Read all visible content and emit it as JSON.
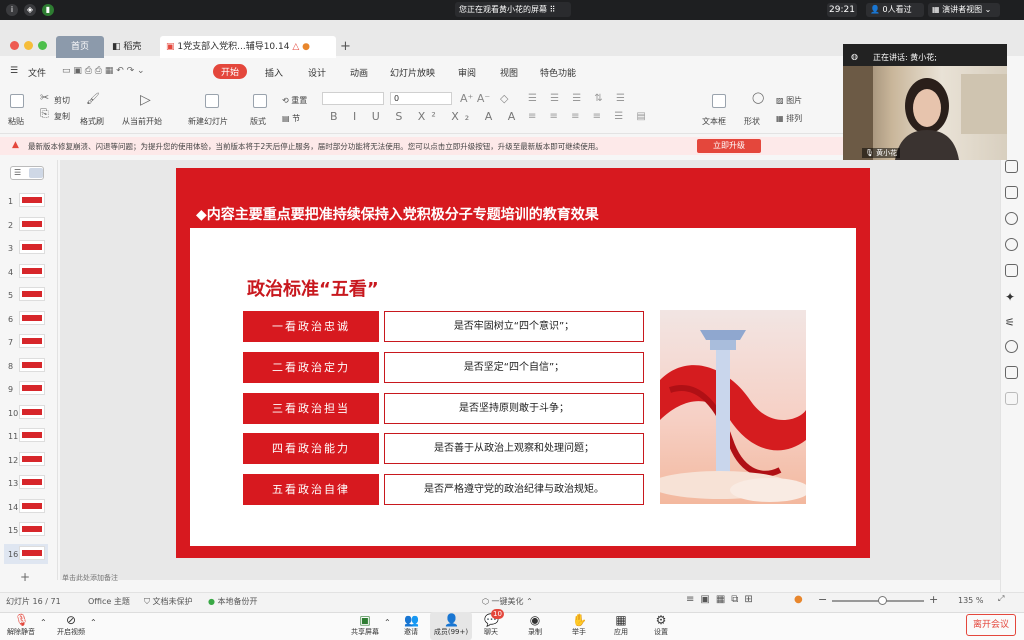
{
  "meeting_top": {
    "share_banner": "您正在观看黄小花的屏幕",
    "timer": "29:21",
    "viewers": "0人看过",
    "view_mode": "演讲者视图"
  },
  "tabs": {
    "home": "首页",
    "doc_brand": "稻壳",
    "file": "1党支部入党积...辅导10.14"
  },
  "menu": {
    "file": "文件",
    "items": [
      "开始",
      "插入",
      "设计",
      "动画",
      "幻灯片放映",
      "审阅",
      "视图",
      "特色功能"
    ]
  },
  "ribbon": {
    "paste": "粘贴",
    "cut": "剪切",
    "copy": "复制",
    "format_painter": "格式刷",
    "from_current": "从当前开始",
    "new_slide": "新建幻灯片",
    "layout": "版式",
    "section": "节",
    "reset": "重置",
    "font_size": "0",
    "textbox": "文本框",
    "shape": "形状",
    "picture": "图片",
    "arrange": "排列"
  },
  "notice": {
    "text": "最新版本修复崩溃、闪退等问题；为提升您的使用体验，当前版本将于2天后停止服务，届时部分功能将无法使用。您可以点击立即升级按钮，升级至最新版本即可继续使用。",
    "button": "立即升级"
  },
  "thumbnails": [
    "1",
    "2",
    "3",
    "4",
    "5",
    "6",
    "7",
    "8",
    "9",
    "10",
    "11",
    "12",
    "13",
    "14",
    "15",
    "16"
  ],
  "slide": {
    "title": "◆内容主要重点要把准持续保持入党积极分子专题培训的教育效果",
    "subtitle": "政治标准“五看”",
    "rows": [
      {
        "label": "一看政治忠诚",
        "desc": "是否牢固树立“四个意识”；"
      },
      {
        "label": "二看政治定力",
        "desc": "是否坚定“四个自信”；"
      },
      {
        "label": "三看政治担当",
        "desc": "是否坚持原则敢于斗争；"
      },
      {
        "label": "四看政治能力",
        "desc": "是否善于从政治上观察和处理问题；"
      },
      {
        "label": "五看政治自律",
        "desc": "是否严格遵守党的政治纪律与政治规矩。"
      }
    ]
  },
  "notes_hint": "单击此处添加备注",
  "status": {
    "slide_count": "幻灯片 16 / 71",
    "theme": "Office 主题",
    "protect": "文档未保护",
    "backup": "本地备份开",
    "beautify": "一键美化",
    "zoom": "135 %"
  },
  "video": {
    "speaking": "正在讲话: 黄小花;",
    "name": "黄小花"
  },
  "meeting_bar": {
    "mute": "解除静音",
    "video": "开启视频",
    "share": "共享屏幕",
    "invite": "邀请",
    "members": "成员(99+)",
    "chat": "聊天",
    "chat_badge": "10",
    "record": "录制",
    "raise_hand": "举手",
    "apps": "应用",
    "settings": "设置",
    "leave": "离开会议"
  },
  "colors": {
    "accent": "#d7191f",
    "upgrade": "#e4473c"
  }
}
